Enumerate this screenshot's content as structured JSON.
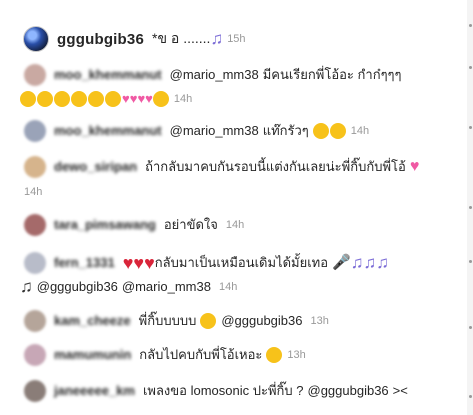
{
  "post": {
    "username": "gggubgib36",
    "caption": "*ข อ .......",
    "caption_icon": "musical-notes-emoji",
    "time": "15h"
  },
  "comments": [
    {
      "name": "moo_khemmanut",
      "mention": "@mario_mm38",
      "text": "มีคนเรียกพี่โอ้อะ กำก๋ๆๆๆ",
      "emojis": [
        "flushed-face",
        "flushed-face",
        "flushed-face",
        "grinning-squint-face",
        "grinning-squint-face",
        "grinning-squint-face",
        "pink-heart",
        "pink-heart",
        "pink-heart",
        "pink-heart",
        "tears-of-joy"
      ],
      "time": "14h",
      "avatar_color": "#c9a9a2"
    },
    {
      "name": "moo_khemmanut",
      "mention": "@mario_mm38",
      "text": "แท๊กรัวๆ",
      "emojis": [
        "winking-tongue-face",
        "tears-of-joy"
      ],
      "time": "14h",
      "avatar_color": "#9aa3b8"
    },
    {
      "name": "dewo_siripan",
      "text": "ถ้ากลับมาคบกันรอบนี้แต่งกันเลยน่ะพี่กิ๊บกับพี่โอ้",
      "emojis": [
        "pink-sparkle-heart"
      ],
      "time": "14h",
      "avatar_color": "#d6b48c"
    },
    {
      "name": "tara_pimsawang",
      "text": "อย่าขัดใจ",
      "time": "14h",
      "avatar_color": "#a56a6a"
    },
    {
      "name": "fern_1331",
      "lead_emojis": [
        "red-heart",
        "red-heart",
        "red-heart"
      ],
      "text": "กลับมาเป็นเหมือนเดิมได้มั้ยเทอ",
      "trail_emojis": [
        "microphone",
        "musical-notes",
        "musical-notes",
        "musical-notes"
      ],
      "second_line_emoji": "musical-notes",
      "mention": "@gggubgib36",
      "mention2": "@mario_mm38",
      "time": "14h",
      "avatar_color": "#b8bcc9"
    },
    {
      "name": "kam_cheeze",
      "text": "พี่กิ๊บบบบบ",
      "emojis": [
        "loudly-crying-face"
      ],
      "mention": "@gggubgib36",
      "time": "13h",
      "avatar_color": "#b5a59a"
    },
    {
      "name": "mamumunin",
      "text": "กลับไปคบกับพี่โอ้เหอะ",
      "emojis": [
        "loudly-crying-face"
      ],
      "time": "13h",
      "avatar_color": "#c7a7b6"
    },
    {
      "name": "janeeeee_km",
      "text": "เพลงขอ lomosonic ปะพี่กิ๊บ ?",
      "mention": "@gggubgib36",
      "trail": "><",
      "avatar_color": "#8a7d78"
    }
  ],
  "colors": {
    "text": "#262626",
    "muted": "#999999",
    "heart": "#d9253a",
    "pink": "#f05aa4"
  }
}
